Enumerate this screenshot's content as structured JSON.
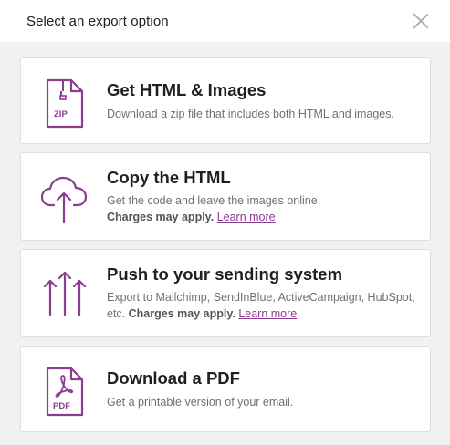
{
  "header": {
    "title": "Select an export option"
  },
  "options": [
    {
      "title": "Get HTML & Images",
      "description": "Download a zip file that includes both HTML and images.",
      "icon": "zip-file-icon",
      "icon_text": "ZIP"
    },
    {
      "title": "Copy the HTML",
      "description": "Get the code and leave the images online.",
      "note": "Charges may apply.",
      "link": "Learn more",
      "icon": "cloud-upload-icon"
    },
    {
      "title": "Push to your sending system",
      "description": "Export to Mailchimp, SendInBlue, ActiveCampaign, HubSpot, etc.",
      "note": "Charges may apply.",
      "link": "Learn more",
      "icon": "arrows-up-icon"
    },
    {
      "title": "Download a PDF",
      "description": "Get a printable version of your email.",
      "icon": "pdf-file-icon",
      "icon_text": "PDF"
    }
  ],
  "colors": {
    "accent": "#8b3d8f",
    "background": "#f1f1f2",
    "card": "#ffffff",
    "border": "#dedede"
  }
}
